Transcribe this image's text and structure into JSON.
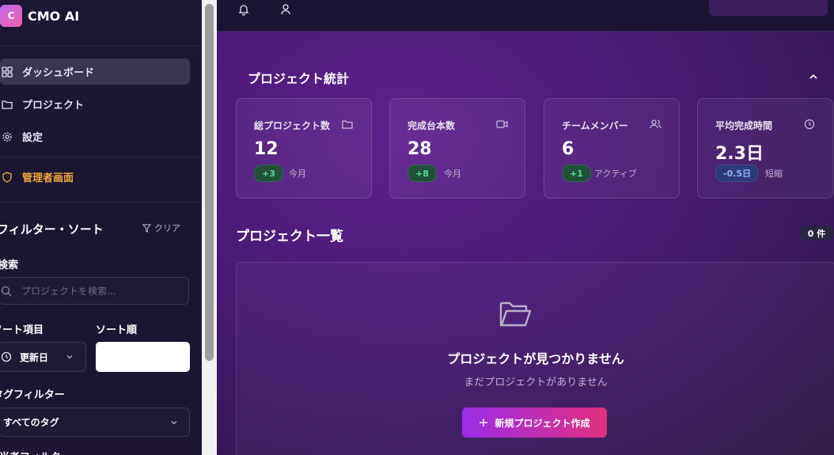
{
  "sidebar": {
    "logo_letter": "C",
    "app_name": "CMO AI",
    "nav": [
      {
        "label": "ダッシュボード",
        "icon": "grid-icon"
      },
      {
        "label": "プロジェクト",
        "icon": "folder-icon"
      },
      {
        "label": "設定",
        "icon": "gear-icon"
      }
    ],
    "admin_label": "管理者画面",
    "filter_title": "フィルター・ソート",
    "clear_label": "クリア",
    "search_label": "検索",
    "search_placeholder": "プロジェクトを検索...",
    "sort_item_label": "ソート項目",
    "sort_item_value": "更新日",
    "sort_order_label": "ソート順",
    "tag_filter_label": "タグフィルター",
    "tag_filter_value": "すべてのタグ",
    "next_label": "担当者フィルター"
  },
  "main": {
    "stats_title": "プロジェクト統計",
    "cards": [
      {
        "title": "総プロジェクト数",
        "value": "12",
        "badge": "+3",
        "sub": "今月",
        "icon": "folder-icon",
        "badge_color": "green"
      },
      {
        "title": "完成台本数",
        "value": "28",
        "badge": "+8",
        "sub": "今月",
        "icon": "video-icon",
        "badge_color": "green"
      },
      {
        "title": "チームメンバー",
        "value": "6",
        "badge": "+1",
        "sub": "アクティブ",
        "icon": "users-icon",
        "badge_color": "green"
      },
      {
        "title": "平均完成時間",
        "value": "2.3日",
        "badge": "-0.5日",
        "sub": "短縮",
        "icon": "clock-icon",
        "badge_color": "blue"
      }
    ],
    "list_title": "プロジェクト一覧",
    "count_badge": "0 件",
    "empty_title": "プロジェクトが見つかりません",
    "empty_subtitle": "まだプロジェクトがありません",
    "new_button": "新規プロジェクト作成"
  },
  "colors": {
    "accent_start": "#9b2be8",
    "accent_end": "#e2307e",
    "admin": "#f0a93b",
    "positive": "#4ee08c",
    "info": "#8fb0ff"
  }
}
